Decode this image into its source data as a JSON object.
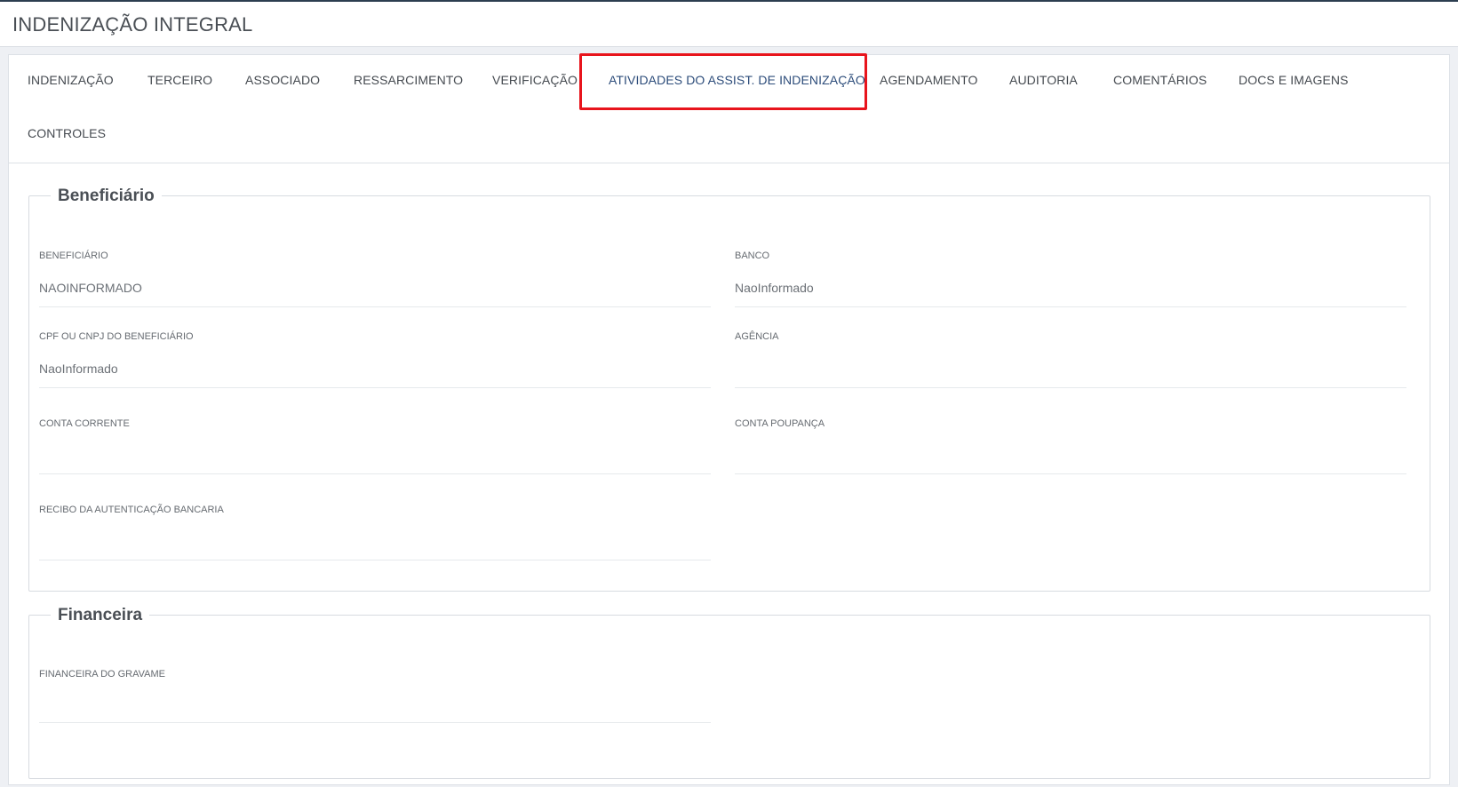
{
  "header": {
    "title": "INDENIZAÇÃO INTEGRAL"
  },
  "tabs": [
    {
      "label": "INDENIZAÇÃO"
    },
    {
      "label": "TERCEIRO"
    },
    {
      "label": "ASSOCIADO"
    },
    {
      "label": "RESSARCIMENTO"
    },
    {
      "label": "VERIFICAÇÃO"
    },
    {
      "label": "ATIVIDADES DO ASSIST. DE INDENIZAÇÃO",
      "active": true
    },
    {
      "label": "AGENDAMENTO"
    },
    {
      "label": "AUDITORIA"
    },
    {
      "label": "COMENTÁRIOS"
    },
    {
      "label": "DOCS E IMAGENS"
    },
    {
      "label": "CONTROLES"
    }
  ],
  "beneficiario": {
    "legend": "Beneficiário",
    "fields": [
      {
        "label": "BENEFICIÁRIO",
        "value": "NAOINFORMADO"
      },
      {
        "label": "BANCO",
        "value": "NaoInformado"
      },
      {
        "label": "CPF OU CNPJ DO BENEFICIÁRIO",
        "value": "NaoInformado"
      },
      {
        "label": "AGÊNCIA",
        "value": ""
      },
      {
        "label": "CONTA CORRENTE",
        "value": ""
      },
      {
        "label": "CONTA POUPANÇA",
        "value": ""
      },
      {
        "label": "RECIBO DA AUTENTICAÇÃO BANCARIA",
        "value": ""
      }
    ]
  },
  "financeira": {
    "legend": "Financeira",
    "fields": [
      {
        "label": "FINANCEIRA DO GRAVAME",
        "value": ""
      }
    ]
  },
  "colors": {
    "highlight_border": "#e8141c",
    "active_tab": "#2c4c7a",
    "topbar_accent": "#2c3e50"
  }
}
